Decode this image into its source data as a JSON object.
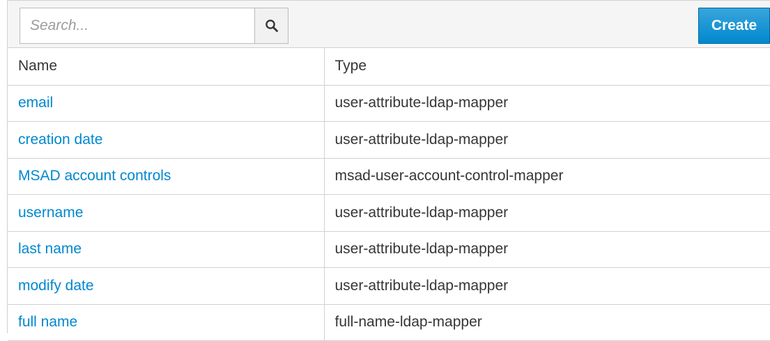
{
  "toolbar": {
    "search_placeholder": "Search...",
    "search_value": "",
    "search_icon": "search-icon",
    "create_label": "Create"
  },
  "table": {
    "columns": [
      "Name",
      "Type"
    ],
    "rows": [
      {
        "name": "email",
        "type": "user-attribute-ldap-mapper"
      },
      {
        "name": "creation date",
        "type": "user-attribute-ldap-mapper"
      },
      {
        "name": "MSAD account controls",
        "type": "msad-user-account-control-mapper"
      },
      {
        "name": "username",
        "type": "user-attribute-ldap-mapper"
      },
      {
        "name": "last name",
        "type": "user-attribute-ldap-mapper"
      },
      {
        "name": "modify date",
        "type": "user-attribute-ldap-mapper"
      },
      {
        "name": "full name",
        "type": "full-name-ldap-mapper"
      }
    ]
  },
  "colors": {
    "link": "#0088ce",
    "primary_button": "#0088ce",
    "toolbar_bg": "#f5f5f5",
    "border": "#d1d1d1"
  }
}
